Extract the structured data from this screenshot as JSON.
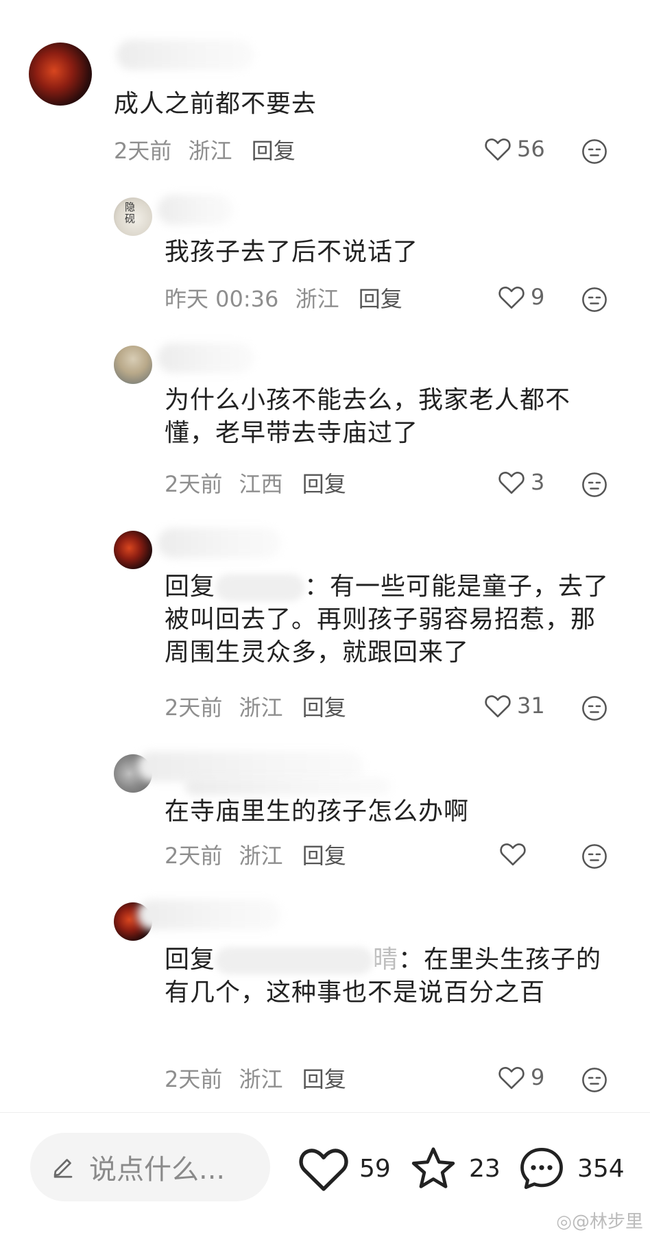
{
  "comments": [
    {
      "text": "成人之前都不要去",
      "time": "2天前",
      "location": "浙江",
      "reply": "回复",
      "likes": "56"
    },
    {
      "text": "我孩子去了后不说话了",
      "time": "昨天 00:36",
      "location": "浙江",
      "reply": "回复",
      "likes": "9"
    },
    {
      "text": "为什么小孩不能去么，我家老人都不懂，老早带去寺庙过了",
      "time": "2天前",
      "location": "江西",
      "reply": "回复",
      "likes": "3"
    },
    {
      "reply_prefix": "回复",
      "text_after": "：有一些可能是童子，去了被叫回去了。再则孩子弱容易招惹，那周围生灵众多，就跟回来了",
      "time": "2天前",
      "location": "浙江",
      "reply": "回复",
      "likes": "31"
    },
    {
      "text": "在寺庙里生的孩子怎么办啊",
      "time": "2天前",
      "location": "浙江",
      "reply": "回复",
      "likes": ""
    },
    {
      "reply_prefix": "回复",
      "reply_target_tail": "晴",
      "text_after": "：在里头生孩子的有几个，这种事也不是说百分之百",
      "time": "2天前",
      "location": "浙江",
      "reply": "回复",
      "likes": "9"
    }
  ],
  "bottom_bar": {
    "placeholder": "说点什么...",
    "likes": "59",
    "favorites": "23",
    "comments": "354"
  },
  "watermark": "@林步里",
  "icons": {
    "like": "heart-icon",
    "face": "neutral-face-icon",
    "pen": "pen-icon",
    "star": "star-icon",
    "chat": "chat-bubble-icon",
    "weibo": "weibo-logo-icon"
  }
}
